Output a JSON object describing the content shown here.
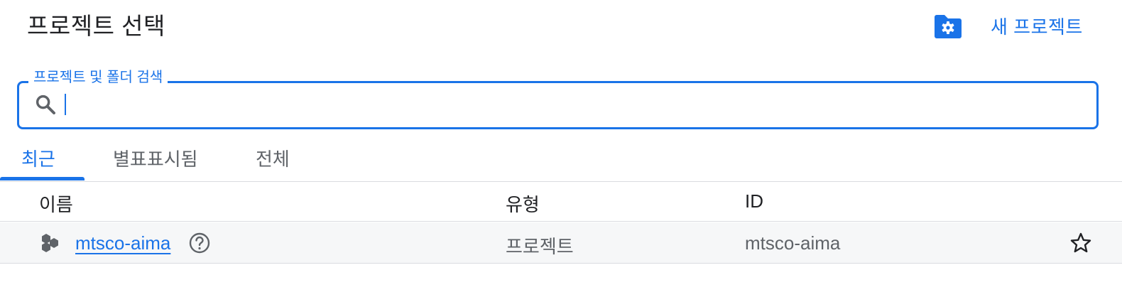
{
  "header": {
    "title": "프로젝트 선택",
    "new_project_label": "새 프로젝트",
    "folder_icon": "folder-settings-icon"
  },
  "search": {
    "label": "프로젝트 및 폴더 검색",
    "value": "",
    "icon": "search-icon"
  },
  "tabs": [
    {
      "label": "최근",
      "active": true
    },
    {
      "label": "별표표시됨",
      "active": false
    },
    {
      "label": "전체",
      "active": false
    }
  ],
  "table": {
    "columns": [
      "이름",
      "유형",
      "ID"
    ],
    "rows": [
      {
        "name": "mtsco-aima",
        "type": "프로젝트",
        "id": "mtsco-aima",
        "icon": "project-hexagons-icon",
        "help_icon": "help-icon",
        "star_icon": "star-outline-icon"
      }
    ]
  },
  "colors": {
    "accent": "#1a73e8",
    "text": "#202124",
    "muted": "#5f6368",
    "divider": "#dadce0",
    "row_bg": "#f6f7f8"
  }
}
